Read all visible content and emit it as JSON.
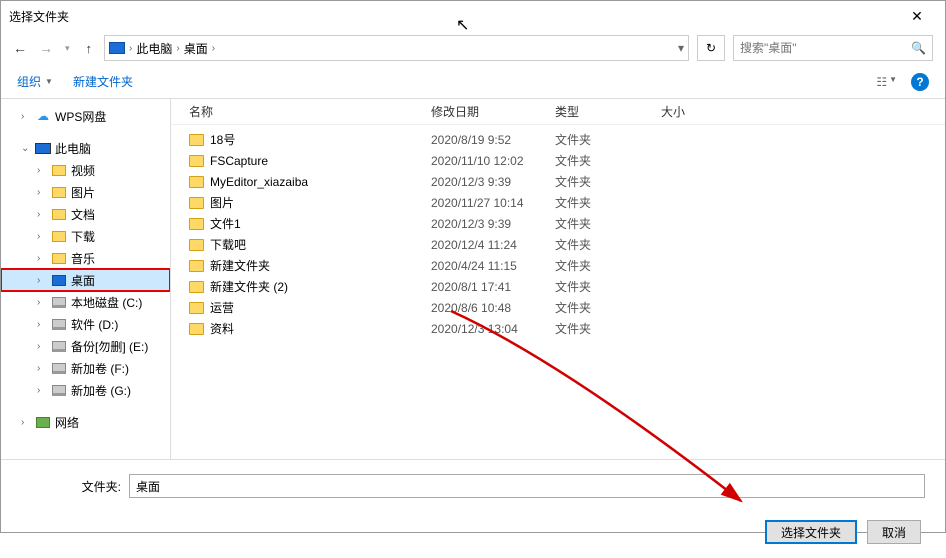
{
  "dialog": {
    "title": "选择文件夹"
  },
  "breadcrumb": {
    "root": "此电脑",
    "current": "桌面"
  },
  "search": {
    "placeholder": "搜索\"桌面\""
  },
  "toolbar": {
    "organize": "组织",
    "new_folder": "新建文件夹"
  },
  "sidebar": {
    "wps": "WPS网盘",
    "this_pc": "此电脑",
    "video": "视频",
    "pictures": "图片",
    "documents": "文档",
    "downloads": "下载",
    "music": "音乐",
    "desktop": "桌面",
    "drive_c": "本地磁盘 (C:)",
    "drive_d": "软件 (D:)",
    "drive_e": "备份[勿删] (E:)",
    "drive_f": "新加卷 (F:)",
    "drive_g": "新加卷 (G:)",
    "network": "网络"
  },
  "columns": {
    "name": "名称",
    "date": "修改日期",
    "type": "类型",
    "size": "大小"
  },
  "files": [
    {
      "name": "18号",
      "date": "2020/8/19 9:52",
      "type": "文件夹"
    },
    {
      "name": "FSCapture",
      "date": "2020/11/10 12:02",
      "type": "文件夹"
    },
    {
      "name": "MyEditor_xiazaiba",
      "date": "2020/12/3 9:39",
      "type": "文件夹"
    },
    {
      "name": "图片",
      "date": "2020/11/27 10:14",
      "type": "文件夹"
    },
    {
      "name": "文件1",
      "date": "2020/12/3 9:39",
      "type": "文件夹"
    },
    {
      "name": "下载吧",
      "date": "2020/12/4 11:24",
      "type": "文件夹"
    },
    {
      "name": "新建文件夹",
      "date": "2020/4/24 11:15",
      "type": "文件夹"
    },
    {
      "name": "新建文件夹 (2)",
      "date": "2020/8/1 17:41",
      "type": "文件夹"
    },
    {
      "name": "运营",
      "date": "2020/8/6 10:48",
      "type": "文件夹"
    },
    {
      "name": "资料",
      "date": "2020/12/3 13:04",
      "type": "文件夹"
    }
  ],
  "footer": {
    "folder_label": "文件夹:",
    "folder_value": "桌面",
    "select_btn": "选择文件夹",
    "cancel_btn": "取消"
  }
}
